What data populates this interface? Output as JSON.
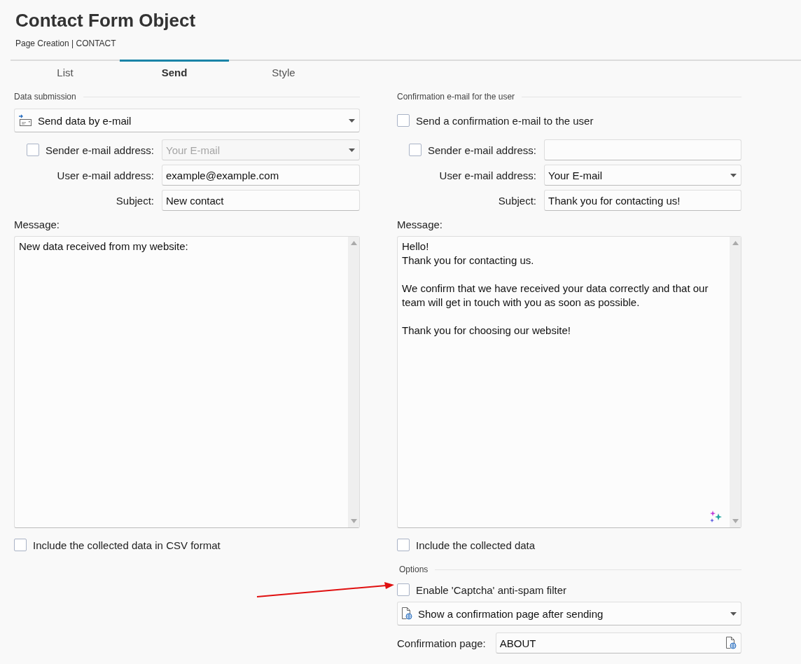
{
  "header": {
    "title": "Contact Form Object",
    "breadcrumb": "Page Creation | CONTACT"
  },
  "tabs": [
    {
      "label": "List",
      "selected": false
    },
    {
      "label": "Send",
      "selected": true
    },
    {
      "label": "Style",
      "selected": false
    }
  ],
  "data_submission": {
    "heading": "Data submission",
    "method": {
      "value": "Send data by e-mail"
    },
    "fields": [
      {
        "kind": "select",
        "label": "Sender e-mail address:",
        "checked": false,
        "value": "Your E-mail",
        "disabled": true
      },
      {
        "kind": "text",
        "label": "User e-mail address:",
        "value": "example@example.com",
        "disabled": false
      },
      {
        "kind": "text",
        "label": "Subject:",
        "value": "New contact",
        "disabled": false
      }
    ],
    "message": {
      "label": "Message:",
      "text": "New data received from my website:"
    },
    "include": {
      "label": "Include the collected data in CSV format",
      "checked": false
    }
  },
  "confirmation_email": {
    "heading": "Confirmation e-mail for the user",
    "send": {
      "label": "Send a confirmation e-mail to the user",
      "checked": false
    },
    "fields": [
      {
        "kind": "text",
        "label": "Sender e-mail address:",
        "checked": false,
        "disabled": false
      },
      {
        "kind": "select",
        "label": "User e-mail address:",
        "value": "Your E-mail",
        "disabled": false
      },
      {
        "kind": "text",
        "label": "Subject:",
        "value": "Thank you for contacting us!",
        "disabled": false
      }
    ],
    "message": {
      "label": "Message:",
      "text": "Hello!\nThank you for contacting us.\n\nWe confirm that we have received your data correctly and that our team will get in touch with you as soon as possible.\n\nThank you for choosing our website!"
    },
    "include": {
      "label": "Include the collected data",
      "checked": false
    }
  },
  "options": {
    "heading": "Options",
    "captcha": {
      "label": "Enable 'Captcha' anti-spam filter",
      "checked": false
    },
    "after_send": {
      "value": "Show a confirmation page after sending"
    },
    "confirmation_page": {
      "label": "Confirmation page:",
      "value": "ABOUT"
    }
  }
}
